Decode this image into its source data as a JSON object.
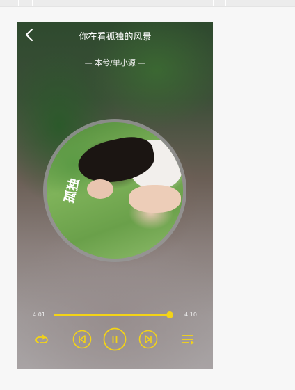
{
  "header": {
    "title": "你在看孤独的风景",
    "artist_line": "— 本兮/单小源 —"
  },
  "album_art": {
    "overlay_text": "孤独"
  },
  "player": {
    "current_time": "4:01",
    "total_time": "4:10",
    "progress": 0.97,
    "state": "playing"
  },
  "controls": {
    "icons": [
      "back-chevron-icon",
      "repeat-icon",
      "previous-track-icon",
      "pause-icon",
      "next-track-icon",
      "playlist-icon"
    ]
  },
  "colors": {
    "accent": "#f3d317",
    "title_text": "#ffffff"
  }
}
